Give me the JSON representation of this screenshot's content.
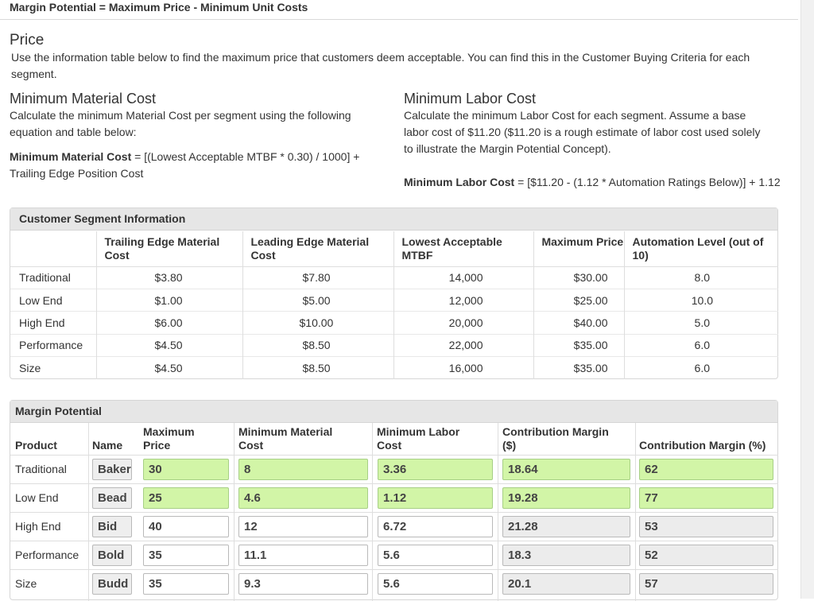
{
  "header": {
    "title": "Margin Potential = Maximum Price - Minimum Unit Costs"
  },
  "price": {
    "heading": "Price",
    "text": "Use the information table below to find the maximum price that customers deem acceptable. You can find this in the Customer Buying Criteria for each segment."
  },
  "material": {
    "heading": "Minimum Material Cost",
    "text": "Calculate the minimum Material Cost per segment using the following equation and table below:",
    "formula_label": "Minimum Material Cost",
    "formula_text": " = [(Lowest Acceptable MTBF * 0.30) / 1000] + Trailing Edge Position Cost"
  },
  "labor": {
    "heading": "Minimum Labor Cost",
    "text": "Calculate the minimum Labor Cost for each segment. Assume a base labor cost of $11.20 ($11.20 is a rough estimate of labor cost used solely to illustrate the Margin Potential Concept).",
    "formula_label": "Minimum Labor Cost",
    "formula_text": " = [$11.20 - (1.12 * Automation Ratings Below)] + 1.12"
  },
  "segment_table": {
    "title": "Customer Segment Information",
    "headers": [
      "",
      "Trailing Edge Material Cost",
      "Leading Edge Material Cost",
      "Lowest Acceptable MTBF",
      "Maximum Price",
      "Automation Level (out of 10)"
    ],
    "rows": [
      [
        "Traditional",
        "$3.80",
        "$7.80",
        "14,000",
        "$30.00",
        "8.0"
      ],
      [
        "Low End",
        "$1.00",
        "$5.00",
        "12,000",
        "$25.00",
        "10.0"
      ],
      [
        "High End",
        "$6.00",
        "$10.00",
        "20,000",
        "$40.00",
        "5.0"
      ],
      [
        "Performance",
        "$4.50",
        "$8.50",
        "22,000",
        "$35.00",
        "6.0"
      ],
      [
        "Size",
        "$4.50",
        "$8.50",
        "16,000",
        "$35.00",
        "6.0"
      ]
    ]
  },
  "margin_table": {
    "title": "Margin Potential",
    "headers": {
      "product": "Product",
      "name": "Name",
      "max_price": "Maximum Price",
      "min_material": "Minimum Material Cost",
      "min_labor": "Minimum Labor Cost",
      "cm_dollar": "Contribution Margin ($)",
      "cm_percent": "Contribution Margin (%)"
    },
    "rows": [
      {
        "product": "Traditional",
        "name": "Baker",
        "max_price": "30",
        "min_material": "8",
        "min_labor": "3.36",
        "cm_dollar": "18.64",
        "cm_percent": "62"
      },
      {
        "product": "Low End",
        "name": "Bead",
        "max_price": "25",
        "min_material": "4.6",
        "min_labor": "1.12",
        "cm_dollar": "19.28",
        "cm_percent": "77"
      },
      {
        "product": "High End",
        "name": "Bid",
        "max_price": "40",
        "min_material": "12",
        "min_labor": "6.72",
        "cm_dollar": "21.28",
        "cm_percent": "53"
      },
      {
        "product": "Performance",
        "name": "Bold",
        "max_price": "35",
        "min_material": "11.1",
        "min_labor": "5.6",
        "cm_dollar": "18.3",
        "cm_percent": "52"
      },
      {
        "product": "Size",
        "name": "Budd",
        "max_price": "35",
        "min_material": "9.3",
        "min_labor": "5.6",
        "cm_dollar": "20.1",
        "cm_percent": "57"
      }
    ]
  },
  "colors": {
    "correct_field": "#d2f5a7",
    "panel_header": "#e6e6e6"
  }
}
